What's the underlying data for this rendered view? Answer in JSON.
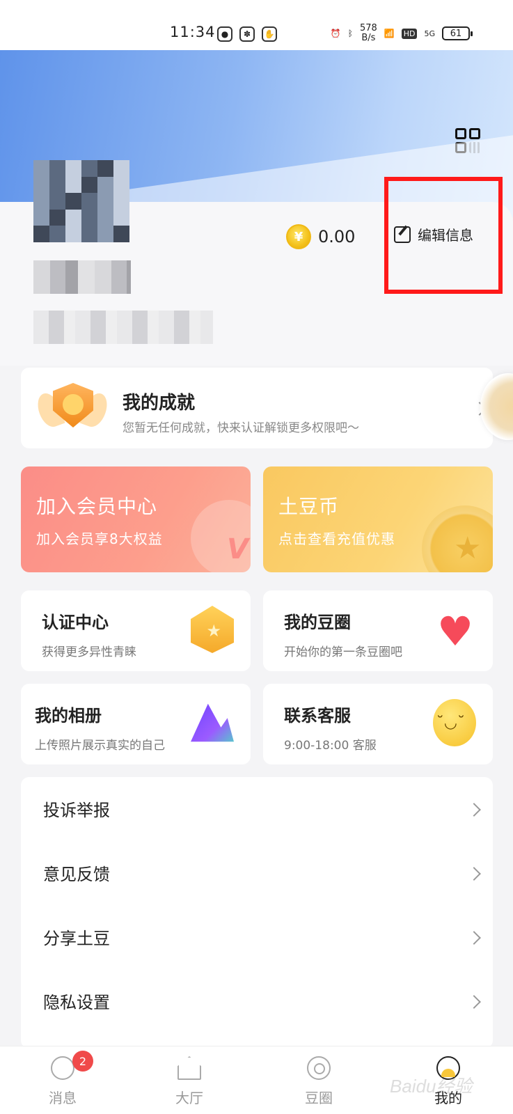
{
  "status_bar": {
    "time": "11:34",
    "netspeed_value": "578",
    "netspeed_unit": "B/s",
    "hd": "HD",
    "signal": "5G",
    "battery": "61"
  },
  "profile": {
    "coin_value": "0.00",
    "edit_label": "编辑信息"
  },
  "achievement": {
    "title": "我的成就",
    "subtitle": "您暂无任何成就，快来认证解锁更多权限吧～"
  },
  "member_card": {
    "title": "加入会员中心",
    "subtitle": "加入会员享8大权益"
  },
  "coin_card": {
    "title": "土豆币",
    "subtitle": "点击查看充值优惠"
  },
  "cards": {
    "cert": {
      "title": "认证中心",
      "subtitle": "获得更多异性青睐"
    },
    "circle": {
      "title": "我的豆圈",
      "subtitle": "开始你的第一条豆圈吧"
    },
    "album": {
      "title": "我的相册",
      "subtitle": "上传照片展示真实的自己"
    },
    "service": {
      "title": "联系客服",
      "subtitle": "9:00-18:00 客服"
    }
  },
  "menu": [
    {
      "label": "投诉举报"
    },
    {
      "label": "意见反馈"
    },
    {
      "label": "分享土豆"
    },
    {
      "label": "隐私设置"
    }
  ],
  "nav": {
    "messages": "消息",
    "messages_badge": "2",
    "hall": "大厅",
    "circle": "豆圈",
    "me": "我的"
  },
  "watermark": "Baidu经验",
  "colors": {
    "highlight": "#ff1a1a",
    "member_card": "#fb8d87",
    "coin_card": "#f9c860",
    "badge": "#f04a4a"
  }
}
